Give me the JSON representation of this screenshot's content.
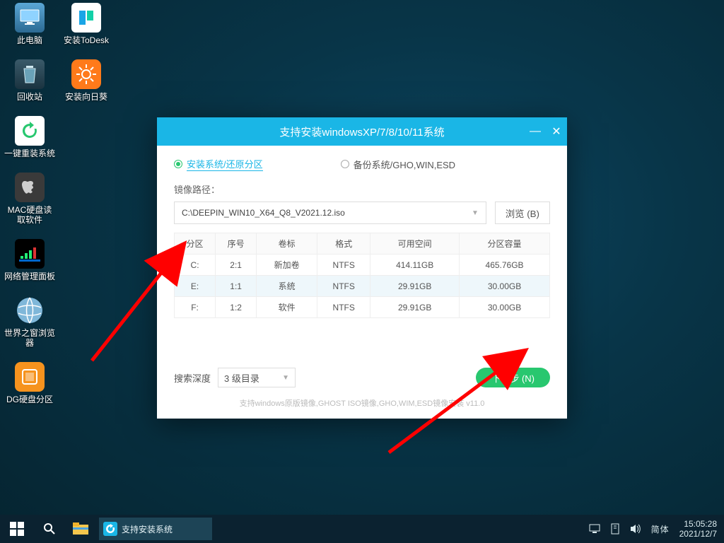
{
  "desktop": {
    "col1": [
      {
        "name": "此电脑"
      },
      {
        "name": "回收站"
      },
      {
        "name": "一键重装系统"
      },
      {
        "name": "MAC硬盘读取软件"
      },
      {
        "name": "网络管理面板"
      },
      {
        "name": "世界之窗浏览器"
      },
      {
        "name": "DG硬盘分区"
      }
    ],
    "col2": [
      {
        "name": "安装ToDesk"
      },
      {
        "name": "安装向日葵"
      }
    ]
  },
  "installer": {
    "title": "支持安装windowsXP/7/8/10/11系统",
    "tab_install": "安装系统/还原分区",
    "tab_backup": "备份系统/GHO,WIN,ESD",
    "path_label": "镜像路径：",
    "path_value": "C:\\DEEPIN_WIN10_X64_Q8_V2021.12.iso",
    "browse": "浏览 (B)",
    "columns": [
      "分区",
      "序号",
      "卷标",
      "格式",
      "可用空间",
      "分区容量"
    ],
    "rows": [
      [
        "C:",
        "2:1",
        "新加卷",
        "NTFS",
        "414.11GB",
        "465.76GB"
      ],
      [
        "E:",
        "1:1",
        "系统",
        "NTFS",
        "29.91GB",
        "30.00GB"
      ],
      [
        "F:",
        "1:2",
        "软件",
        "NTFS",
        "29.91GB",
        "30.00GB"
      ]
    ],
    "selected_row_index": 1,
    "depth_label": "搜索深度",
    "depth_value": "3 级目录",
    "next": "下一步 (N)",
    "hint": "支持windows原版镜像,GHOST ISO镜像,GHO,WIM,ESD镜像安装    v11.0"
  },
  "taskbar": {
    "active_task": "支持安装系统",
    "ime": "简体",
    "time": "15:05:28",
    "date": "2021/12/7"
  },
  "colors": {
    "accent": "#1ab6e6",
    "ok": "#28c76f"
  }
}
